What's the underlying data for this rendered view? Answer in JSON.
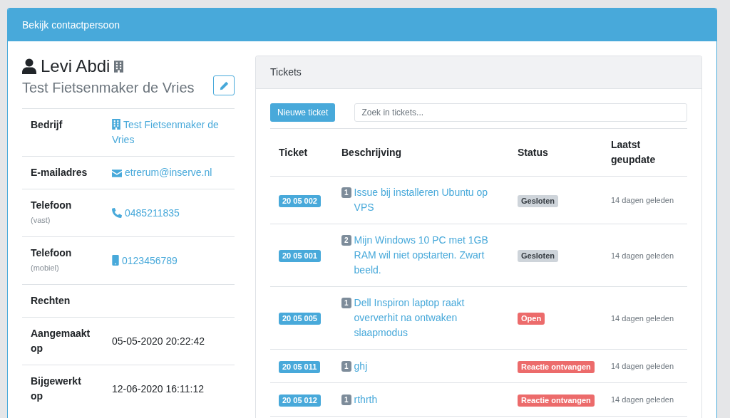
{
  "header": {
    "title": "Bekijk contactpersoon"
  },
  "contact": {
    "name": "Levi Abdi",
    "company": "Test Fietsenmaker de Vries"
  },
  "details": [
    {
      "label": "Bedrijf",
      "kind": "company",
      "value": "Test Fietsenmaker de Vries"
    },
    {
      "label": "E-mailadres",
      "kind": "email",
      "value": "etrerum@inserve.nl"
    },
    {
      "label": "Telefoon",
      "sublabel": "(vast)",
      "kind": "phone",
      "value": "0485211835"
    },
    {
      "label": "Telefoon",
      "sublabel": "(mobiel)",
      "kind": "mobile",
      "value": "0123456789"
    },
    {
      "label": "Rechten"
    },
    {
      "label": "Aangemaakt op",
      "kind": "text",
      "value": "05-05-2020 20:22:42"
    },
    {
      "label": "Bijgewerkt op",
      "kind": "text",
      "value": "12-06-2020 16:11:12"
    }
  ],
  "tickets": {
    "title": "Tickets",
    "new_button": "Nieuwe ticket",
    "search": {
      "placeholder": "Zoek in tickets..."
    },
    "columns": [
      "Ticket",
      "Beschrijving",
      "Status",
      "Laatst geupdate"
    ],
    "rows": [
      {
        "number": "20 05 002",
        "count": "1",
        "description": "Issue bij installeren Ubuntu op VPS",
        "status": {
          "label": "Gesloten",
          "color": "#ced4da"
        },
        "updated": "14 dagen geleden"
      },
      {
        "number": "20 05 001",
        "count": "2",
        "description": "Mijn Windows 10 PC met 1GB RAM wil niet opstarten. Zwart beeld.",
        "status": {
          "label": "Gesloten",
          "color": "#ced4da"
        },
        "updated": "14 dagen geleden"
      },
      {
        "number": "20 05 005",
        "count": "1",
        "description": "Dell Inspiron laptop raakt oververhit na ontwaken slaapmodus",
        "status": {
          "label": "Open",
          "color": "#ec6b6b"
        },
        "updated": "14 dagen geleden"
      },
      {
        "number": "20 05 011",
        "count": "1",
        "description": "ghj",
        "status": {
          "label": "Reactie ontvangen",
          "color": "#ec6b6b"
        },
        "updated": "14 dagen geleden"
      },
      {
        "number": "20 05 012",
        "count": "1",
        "description": "rthrth",
        "status": {
          "label": "Reactie ontvangen",
          "color": "#ec6b6b"
        },
        "updated": "14 dagen geleden"
      }
    ]
  }
}
